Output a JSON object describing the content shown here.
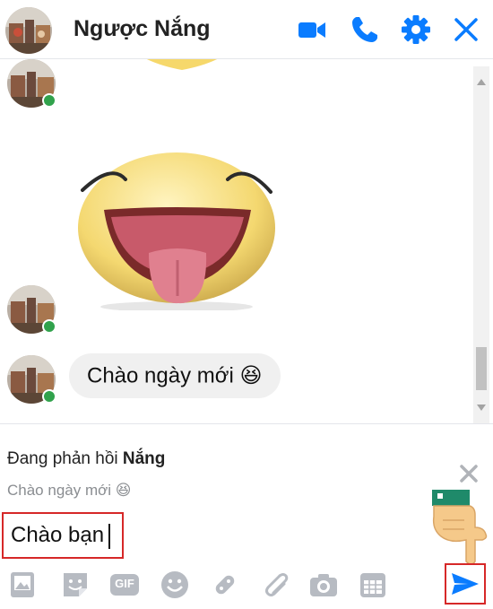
{
  "header": {
    "contact_name": "Ngược Nắng",
    "icons": [
      "video-call-icon",
      "voice-call-icon",
      "settings-icon",
      "close-icon"
    ],
    "accent_color": "#0a7cff"
  },
  "conversation": {
    "messages": [
      {
        "type": "sticker",
        "description_icon": "tongue-out-emoji-sticker"
      },
      {
        "type": "sticker",
        "description_icon": "tongue-out-emoji-sticker"
      },
      {
        "type": "text",
        "text": "Chào ngày mới",
        "emoji": "😆"
      }
    ],
    "online_status_color": "#31a24c"
  },
  "reply": {
    "prefix": "Đang phản hồi ",
    "name": "Nắng",
    "quoted_text": "Chào ngày mới",
    "quoted_emoji": "😆"
  },
  "composer": {
    "value": "Chào bạn",
    "toolbar_icons": [
      "image-icon",
      "sticker-icon",
      "gif-icon",
      "emoji-icon",
      "game-icon",
      "attachment-icon",
      "camera-icon",
      "calendar-icon"
    ],
    "gif_label": "GIF",
    "send_icon": "send-icon"
  },
  "annotation_color": "#d62828"
}
